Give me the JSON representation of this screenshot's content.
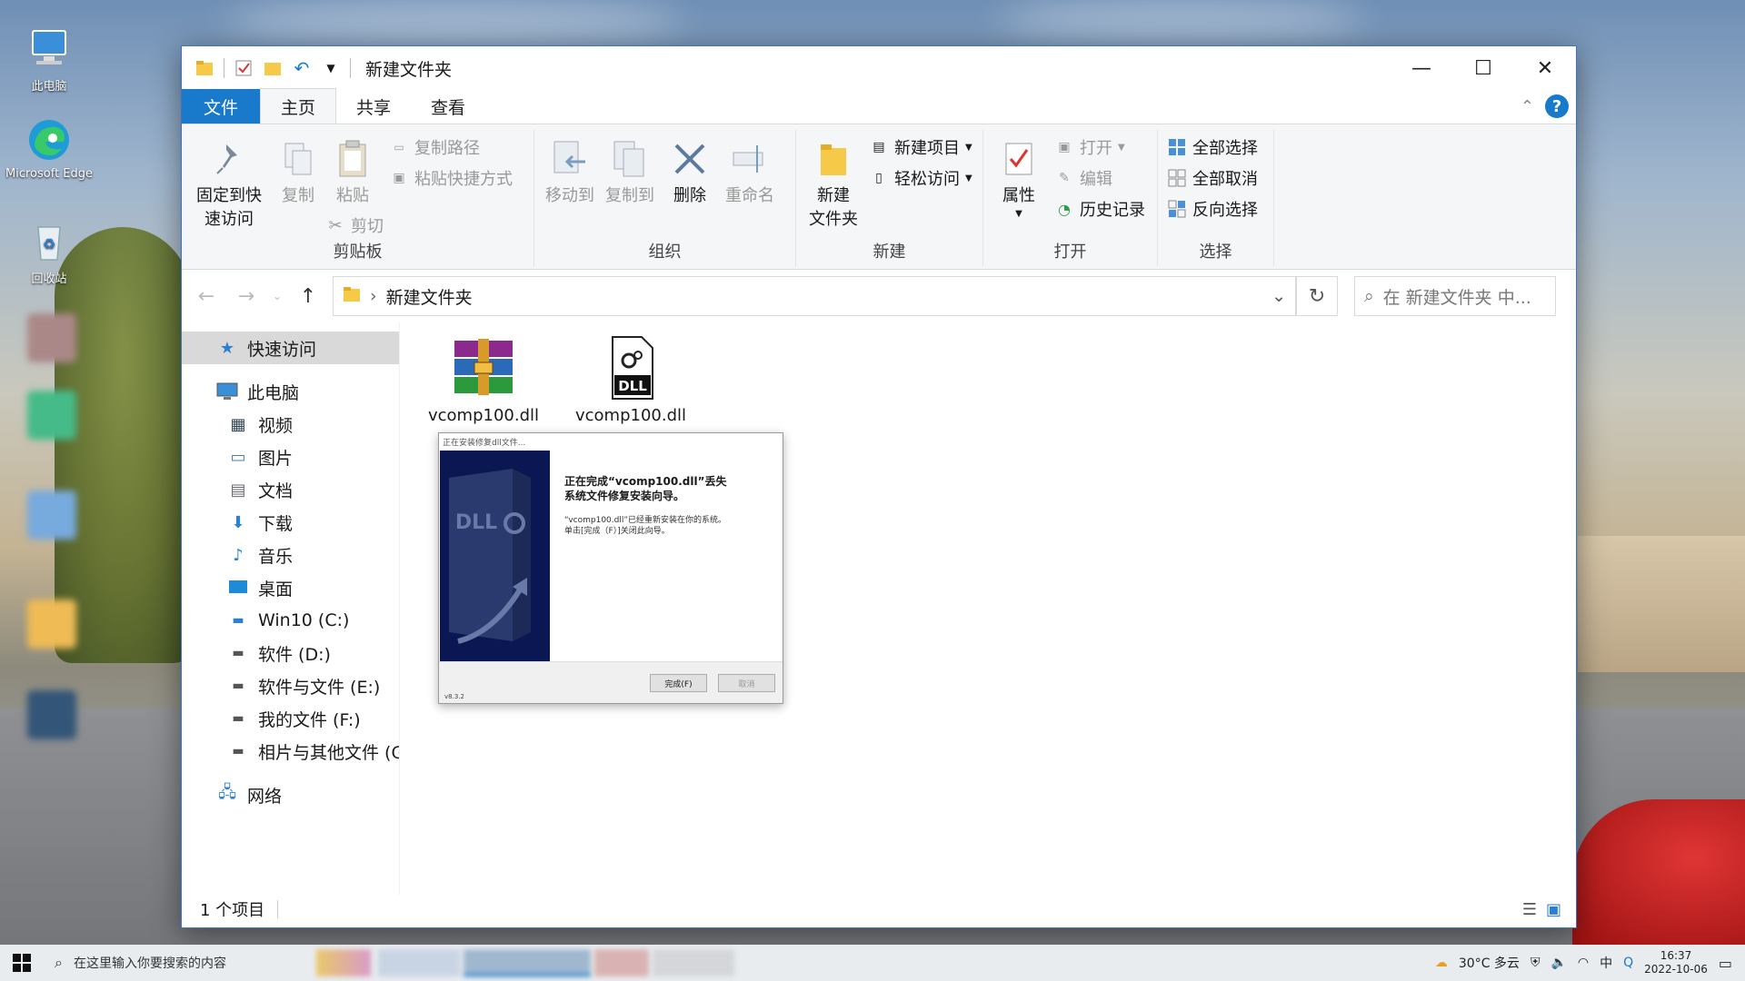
{
  "desktop": {
    "icons": [
      {
        "label": "此电脑"
      },
      {
        "label": "Microsoft Edge"
      },
      {
        "label": "回收站"
      }
    ]
  },
  "window": {
    "title": "新建文件夹",
    "tabs": [
      "文件",
      "主页",
      "共享",
      "查看"
    ],
    "active_tab": "主页"
  },
  "ribbon": {
    "clipboard": {
      "pin_line1": "固定到快",
      "pin_line2": "速访问",
      "copy": "复制",
      "paste": "粘贴",
      "copy_path": "复制路径",
      "paste_shortcut": "粘贴快捷方式",
      "cut": "剪切",
      "label": "剪贴板"
    },
    "organize": {
      "move_to": "移动到",
      "copy_to": "复制到",
      "delete": "删除",
      "rename": "重命名",
      "label": "组织"
    },
    "new": {
      "new_folder_line1": "新建",
      "new_folder_line2": "文件夹",
      "new_item": "新建项目",
      "easy_access": "轻松访问",
      "label": "新建"
    },
    "open": {
      "properties": "属性",
      "open": "打开",
      "edit": "编辑",
      "history": "历史记录",
      "label": "打开"
    },
    "select": {
      "select_all": "全部选择",
      "select_none": "全部取消",
      "invert": "反向选择",
      "label": "选择"
    }
  },
  "address": {
    "path": "新建文件夹",
    "search_placeholder": "在 新建文件夹 中..."
  },
  "navpane": {
    "quick_access": "快速访问",
    "this_pc": "此电脑",
    "items": [
      "视频",
      "图片",
      "文档",
      "下载",
      "音乐",
      "桌面",
      "Win10 (C:)",
      "软件 (D:)",
      "软件与文件 (E:)",
      "我的文件 (F:)",
      "相片与其他文件 (G:"
    ],
    "network": "网络"
  },
  "files": [
    {
      "name": "vcomp100.dll",
      "icon": "winrar-archive-icon"
    },
    {
      "name": "vcomp100.dll",
      "icon": "dll-file-icon"
    }
  ],
  "status": {
    "count": "1 个项目"
  },
  "dialog": {
    "title": "正在安装修复dll文件...",
    "heading_line1": "正在完成“vcomp100.dll”丢失",
    "heading_line2": "系统文件修复安装向导。",
    "text_line1": "“vcomp100.dll”已经重新安装在你的系统。",
    "text_line2": "单击[完成（F）]关闭此向导。",
    "finish": "完成(F)",
    "cancel": "取消",
    "version": "v8.3.2",
    "side_text": "DLL"
  },
  "taskbar": {
    "search_placeholder": "在这里输入你要搜索的内容",
    "weather": "30°C 多云",
    "time": "16:37",
    "date": "2022-10-06"
  },
  "colors": {
    "accent": "#1979ca",
    "dialog_side": "#0a1752"
  }
}
